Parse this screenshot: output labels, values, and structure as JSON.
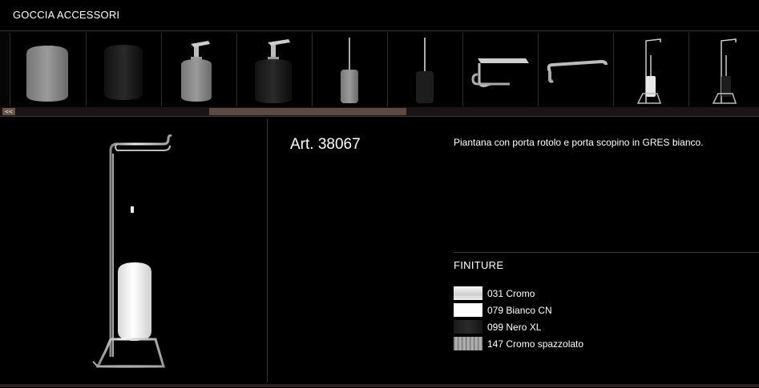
{
  "header": {
    "title": "GOCCIA ACCESSORI"
  },
  "gallery": {
    "scroll_prev_label": "<<",
    "items": [
      {
        "name": "cup-white"
      },
      {
        "name": "cup-black"
      },
      {
        "name": "soap-dispenser-white"
      },
      {
        "name": "soap-dispenser-black"
      },
      {
        "name": "toilet-brush-white"
      },
      {
        "name": "toilet-brush-black"
      },
      {
        "name": "paper-holder-cover"
      },
      {
        "name": "towel-hook"
      },
      {
        "name": "floor-stand-white"
      },
      {
        "name": "floor-stand-black"
      }
    ]
  },
  "product": {
    "article": "Art. 38067",
    "description": "Piantana con porta rotolo e porta scopino in GRES bianco."
  },
  "finishes": {
    "title": "FINITURE",
    "items": [
      {
        "code": "031 Cromo"
      },
      {
        "code": "079 Bianco CN"
      },
      {
        "code": "099 Nero XL"
      },
      {
        "code": "147 Cromo spazzolato"
      }
    ]
  }
}
